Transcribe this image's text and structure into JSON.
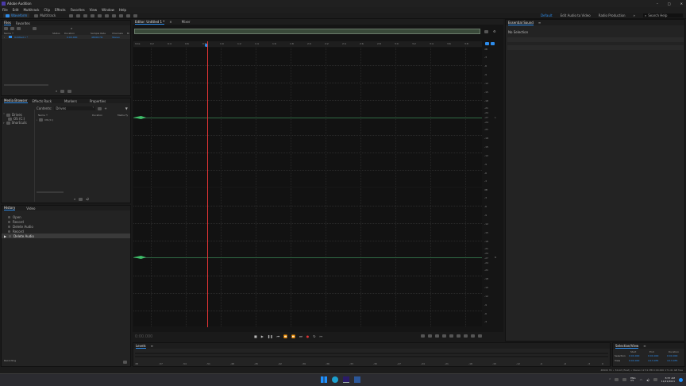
{
  "app": {
    "title": "Adobe Audition",
    "window_controls": [
      "–",
      "□",
      "✕"
    ]
  },
  "menu": [
    "File",
    "Edit",
    "Multitrack",
    "Clip",
    "Effects",
    "Favorites",
    "View",
    "Window",
    "Help"
  ],
  "toolbar": {
    "waveform_label": "Waveform",
    "multitrack_label": "Multitrack",
    "workspaces": [
      "Default",
      "Edit Audio to Video",
      "Radio Production"
    ],
    "search_placeholder": "Search Help"
  },
  "files_panel": {
    "tabs": [
      "Files",
      "Favorites"
    ],
    "columns": [
      "Name ↑",
      "Status",
      "Duration",
      "Sample Rate",
      "Channels",
      "Bi"
    ],
    "rows": [
      {
        "name": "Untitled 1 *",
        "duration": "0:00.000",
        "sample_rate": "48000 Hz",
        "channels": "Stereo"
      }
    ]
  },
  "media_browser": {
    "tabs": [
      "Media Browser",
      "Effects Rack",
      "Markers",
      "Properties"
    ],
    "contents_label": "Contents:",
    "contents_value": "Drives",
    "tree": [
      "Drives",
      "OS (C:)",
      "Shortcuts"
    ],
    "columns": [
      "Name ↑",
      "Duration",
      "Media Ty"
    ],
    "rows": [
      "OS (C:)"
    ]
  },
  "history": {
    "tabs": [
      "History",
      "Video"
    ],
    "items": [
      "Open",
      "Record",
      "Delete Audio",
      "Record",
      "Delete Audio"
    ],
    "status": "Recording"
  },
  "editor": {
    "tabs": [
      "Editor: Untitled 1 *",
      "Mixer"
    ],
    "ruler": [
      "hms",
      "0:2",
      "0:4",
      "0:6",
      "0:8",
      "1:0",
      "1:2",
      "1:4",
      "1:6",
      "1:8",
      "2:0",
      "2:2",
      "2:4",
      "2:6",
      "2:8",
      "3:0",
      "3:2",
      "3:4",
      "3:6",
      "3:8",
      "4:0",
      "4:2"
    ],
    "db_top": [
      "dB",
      "-3",
      "-6",
      "-9",
      "-12",
      "-15",
      "-18",
      "-21",
      "-24",
      "-27",
      "-24",
      "-21",
      "-18",
      "-15",
      "-12",
      "-9",
      "-6",
      "-3"
    ],
    "db_bottom": [
      "dB",
      "-3",
      "-6",
      "-9",
      "-12",
      "-15",
      "-18",
      "-21",
      "-24",
      "-27",
      "-24",
      "-21",
      "-18",
      "-15",
      "-12",
      "-9",
      "-6",
      "-3"
    ],
    "channel_labels": [
      "L",
      "R"
    ],
    "time_display": "0:00.000"
  },
  "levels": {
    "title": "Levels",
    "scale": [
      "dB",
      "-57",
      "-54",
      "-51",
      "-48",
      "-45",
      "-42",
      "-39",
      "-36",
      "-33",
      "-30",
      "-27",
      "-24",
      "-21",
      "-18",
      "-15",
      "-12",
      "-9",
      "-6",
      "-3",
      "0"
    ]
  },
  "essential_sound": {
    "title": "Essential Sound",
    "no_selection": "No Selection"
  },
  "selection_view": {
    "title": "Selection/View",
    "headers": [
      "",
      "Start",
      "End",
      "Duration"
    ],
    "rows": [
      {
        "label": "Selection",
        "start": "0:00.000",
        "end": "0:00.000",
        "duration": "0:00.000"
      },
      {
        "label": "View",
        "start": "0:00.000",
        "end": "4:13.055",
        "duration": "4:13.055"
      }
    ]
  },
  "statusbar": {
    "right": "48000 Hz • 32-bit (float) • Stereo   12.51 MB   0:00.000   171.41 GB free"
  },
  "taskbar": {
    "clock_time": "8:57 AM",
    "clock_date": "11/21/2021",
    "lang": "ENG",
    "lang2": "US"
  },
  "colors": {
    "accent": "#2d8ceb",
    "playhead": "#dd3333",
    "waveform": "#3fbf6a"
  }
}
